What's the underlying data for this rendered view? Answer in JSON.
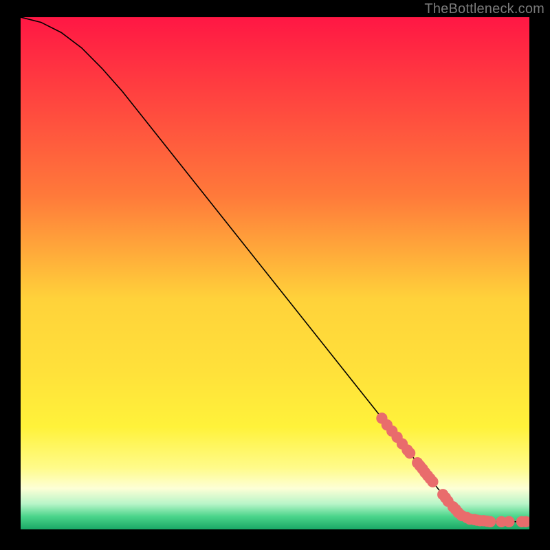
{
  "watermark": "TheBottleneck.com",
  "chart_data": {
    "type": "line",
    "title": "",
    "xlabel": "",
    "ylabel": "",
    "xlim": [
      0,
      100
    ],
    "ylim": [
      0,
      100
    ],
    "curve": {
      "name": "bottleneck-curve",
      "x": [
        0,
        4,
        8,
        12,
        16,
        20,
        24,
        28,
        32,
        36,
        40,
        44,
        48,
        52,
        56,
        60,
        64,
        68,
        72,
        76,
        80,
        84,
        88,
        92,
        96,
        100
      ],
      "y": [
        100,
        99,
        97,
        94,
        90,
        85.5,
        80.5,
        75.5,
        70.5,
        65.5,
        60.5,
        55.5,
        50.5,
        45.5,
        40.5,
        35.5,
        30.5,
        25.5,
        20.5,
        15.5,
        10.5,
        5.5,
        2.0,
        1.5,
        1.5,
        1.5
      ]
    },
    "markers": {
      "name": "marker-points",
      "color": "#e96c6c",
      "radius": 1.1,
      "x": [
        71,
        72,
        73,
        74,
        75,
        76,
        76.5,
        78,
        78.5,
        79,
        79.5,
        80,
        80.5,
        81,
        83,
        83.5,
        84,
        85,
        85.5,
        86,
        86.7,
        87.7,
        88.3,
        89.2,
        89.7,
        90.3,
        91,
        91.7,
        92.3,
        94.5,
        96,
        98.5,
        99.3
      ],
      "y": [
        21.7,
        20.4,
        19.2,
        18.0,
        16.7,
        15.5,
        14.9,
        13.0,
        12.4,
        11.8,
        11.1,
        10.5,
        9.9,
        9.3,
        6.8,
        6.2,
        5.5,
        4.4,
        3.9,
        3.3,
        2.7,
        2.3,
        2.0,
        1.9,
        1.8,
        1.7,
        1.7,
        1.6,
        1.5,
        1.5,
        1.5,
        1.5,
        1.5
      ]
    },
    "background": {
      "type": "vertical-gradient",
      "stops": [
        {
          "offset": 0.0,
          "color": "#ff1744"
        },
        {
          "offset": 0.35,
          "color": "#ff7a3a"
        },
        {
          "offset": 0.55,
          "color": "#ffd23a"
        },
        {
          "offset": 0.7,
          "color": "#ffe23a"
        },
        {
          "offset": 0.8,
          "color": "#fff23a"
        },
        {
          "offset": 0.88,
          "color": "#fffb8a"
        },
        {
          "offset": 0.92,
          "color": "#fdffd6"
        },
        {
          "offset": 0.95,
          "color": "#b8f5c8"
        },
        {
          "offset": 0.975,
          "color": "#4ad48a"
        },
        {
          "offset": 1.0,
          "color": "#1aa866"
        }
      ]
    }
  }
}
